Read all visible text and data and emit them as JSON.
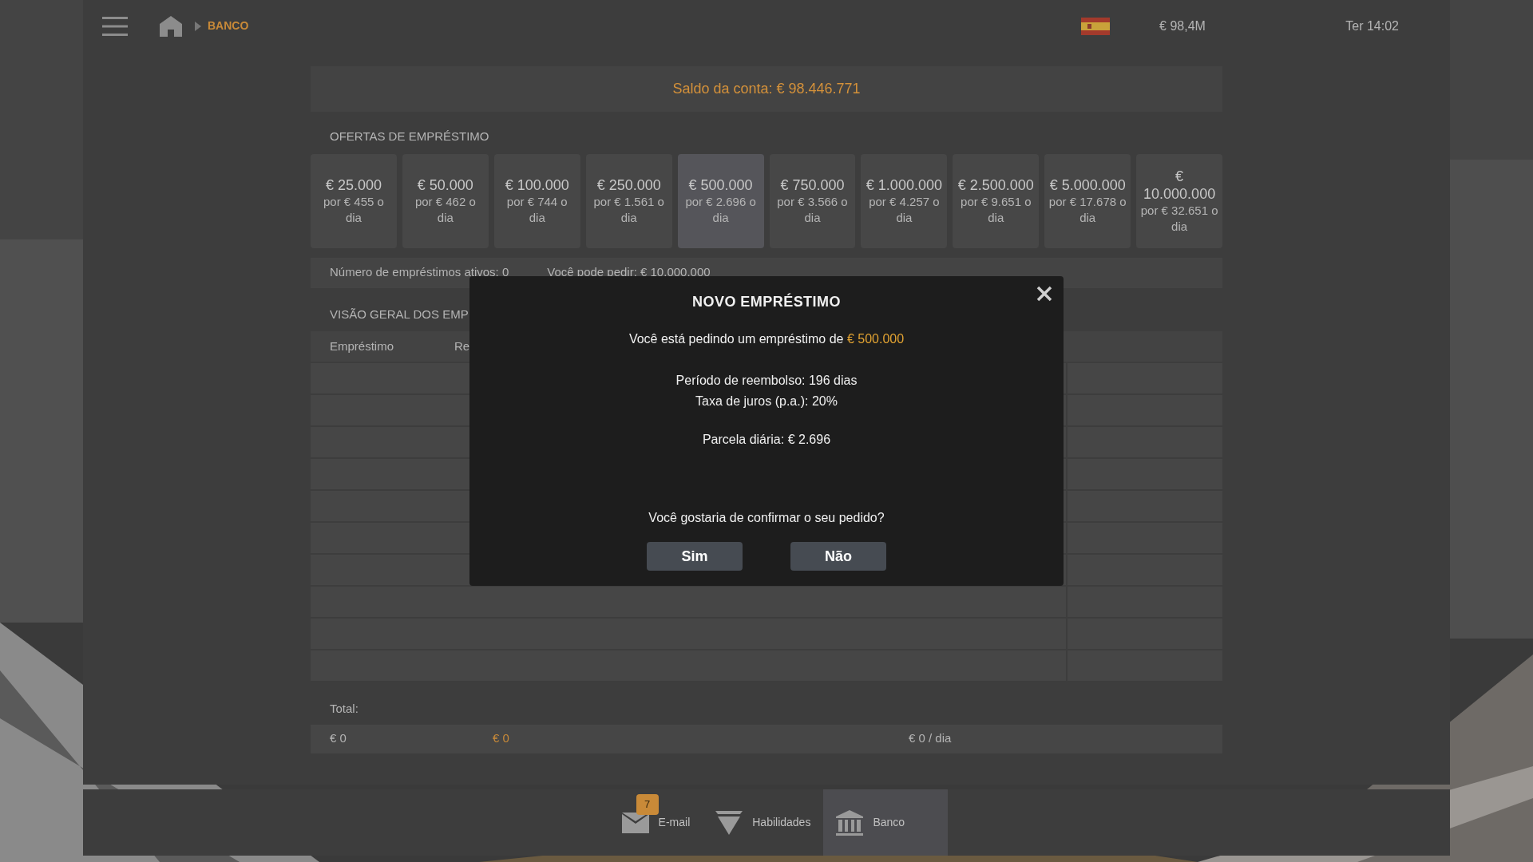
{
  "top_bar": {
    "breadcrumb": "BANCO",
    "money": "€ 98,4M",
    "clock": "Ter 14:02"
  },
  "balance": "Saldo da conta: € 98.446.771",
  "offers": {
    "title": "OFERTAS DE EMPRÉSTIMO",
    "items": [
      {
        "amount": "€ 25.000",
        "daily": "por € 455 o dia",
        "selected": false
      },
      {
        "amount": "€ 50.000",
        "daily": "por € 462 o dia",
        "selected": false
      },
      {
        "amount": "€ 100.000",
        "daily": "por € 744 o dia",
        "selected": false
      },
      {
        "amount": "€ 250.000",
        "daily": "por € 1.561 o dia",
        "selected": false
      },
      {
        "amount": "€ 500.000",
        "daily": "por € 2.696 o dia",
        "selected": true
      },
      {
        "amount": "€ 750.000",
        "daily": "por € 3.566 o dia",
        "selected": false
      },
      {
        "amount": "€ 1.000.000",
        "daily": "por € 4.257 o dia",
        "selected": false
      },
      {
        "amount": "€ 2.500.000",
        "daily": "por € 9.651 o dia",
        "selected": false
      },
      {
        "amount": "€ 5.000.000",
        "daily": "por € 17.678 o dia",
        "selected": false
      },
      {
        "amount": "€ 10.000.000",
        "daily": "por € 32.651 o dia",
        "selected": false
      }
    ]
  },
  "status": {
    "active_loans": "Número de empréstimos ativos: 0",
    "can_request": "Você pode pedir: € 10.000.000"
  },
  "overview": {
    "title": "VISÃO GERAL DOS EMP",
    "columns": [
      "Empréstimo",
      "Re"
    ]
  },
  "totals": {
    "label": "Total:",
    "loan": "€ 0",
    "remaining": "€ 0",
    "installment": "€ 0 / dia"
  },
  "dialog": {
    "title": "NOVO EMPRÉSTIMO",
    "request_text": "Você está pedindo um empréstimo de",
    "request_amount": "€ 500.000",
    "period": "Período de reembolso: 196 dias",
    "interest": "Taxa de juros (p.a.): 20%",
    "installment": "Parcela diária: € 2.696",
    "question": "Você gostaria de confirmar o seu pedido?",
    "buttons": [
      "Sim",
      "Não"
    ]
  },
  "dock": [
    {
      "label": "E-mail",
      "kind": "mail",
      "badge": "7",
      "selected": false
    },
    {
      "label": "Habilidades",
      "kind": "skills",
      "selected": false
    },
    {
      "label": "Banco",
      "kind": "bank",
      "selected": true
    }
  ]
}
